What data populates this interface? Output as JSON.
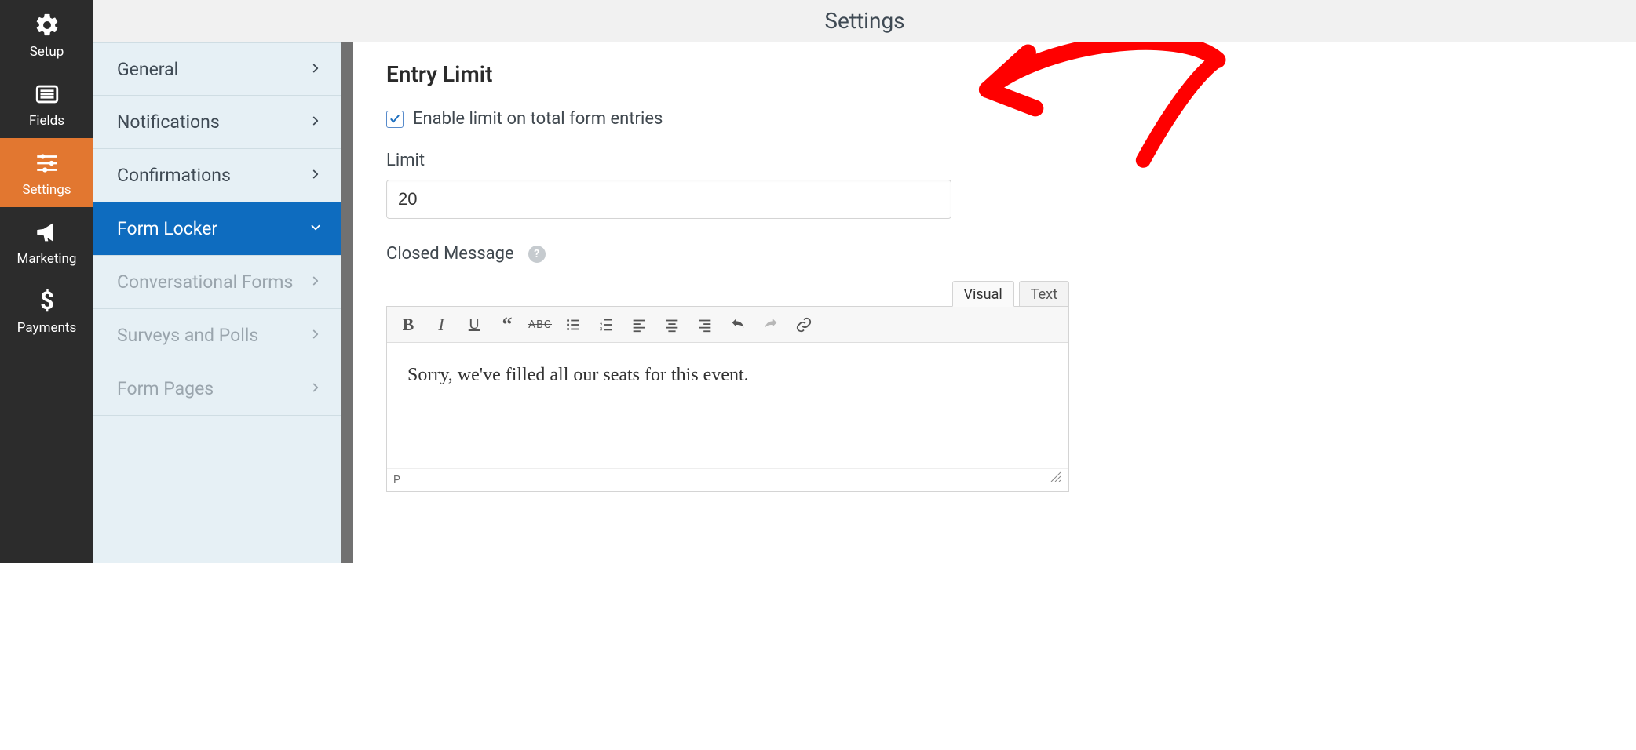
{
  "colors": {
    "accent": "#e27730",
    "link": "#0e6cbf",
    "annotation": "#ff0000"
  },
  "header": {
    "title": "Settings"
  },
  "primary_nav": {
    "items": [
      {
        "label": "Setup"
      },
      {
        "label": "Fields"
      },
      {
        "label": "Settings"
      },
      {
        "label": "Marketing"
      },
      {
        "label": "Payments"
      }
    ]
  },
  "secondary_nav": {
    "items": [
      {
        "label": "General",
        "state": "normal"
      },
      {
        "label": "Notifications",
        "state": "normal"
      },
      {
        "label": "Confirmations",
        "state": "normal"
      },
      {
        "label": "Form Locker",
        "state": "active"
      },
      {
        "label": "Conversational Forms",
        "state": "inactive"
      },
      {
        "label": "Surveys and Polls",
        "state": "inactive"
      },
      {
        "label": "Form Pages",
        "state": "inactive"
      }
    ]
  },
  "entry_limit": {
    "heading": "Entry Limit",
    "enable_label": "Enable limit on total form entries",
    "enable_checked": true,
    "limit_label": "Limit",
    "limit_value": "20",
    "closed_label": "Closed Message"
  },
  "editor": {
    "tabs": {
      "visual": "Visual",
      "text": "Text",
      "active": "visual"
    },
    "body": "Sorry, we've filled all our seats for this event.",
    "status_path": "P"
  }
}
